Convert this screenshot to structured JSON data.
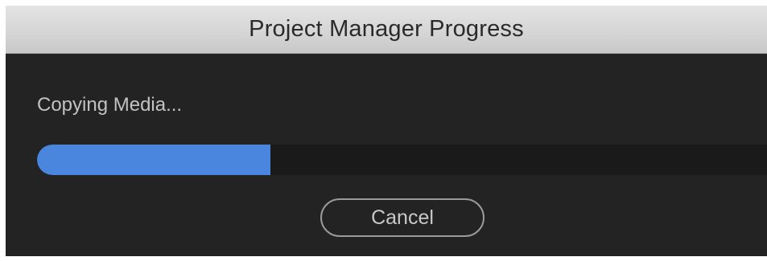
{
  "dialog": {
    "title": "Project Manager Progress",
    "status": "Copying Media...",
    "progress_fraction": 0.32,
    "cancel_label": "Cancel"
  },
  "colors": {
    "title_bar": "#d6d6d6",
    "background": "#232323",
    "track": "#1a1a1a",
    "fill": "#4a86dd",
    "text": "#c2c2c2"
  }
}
